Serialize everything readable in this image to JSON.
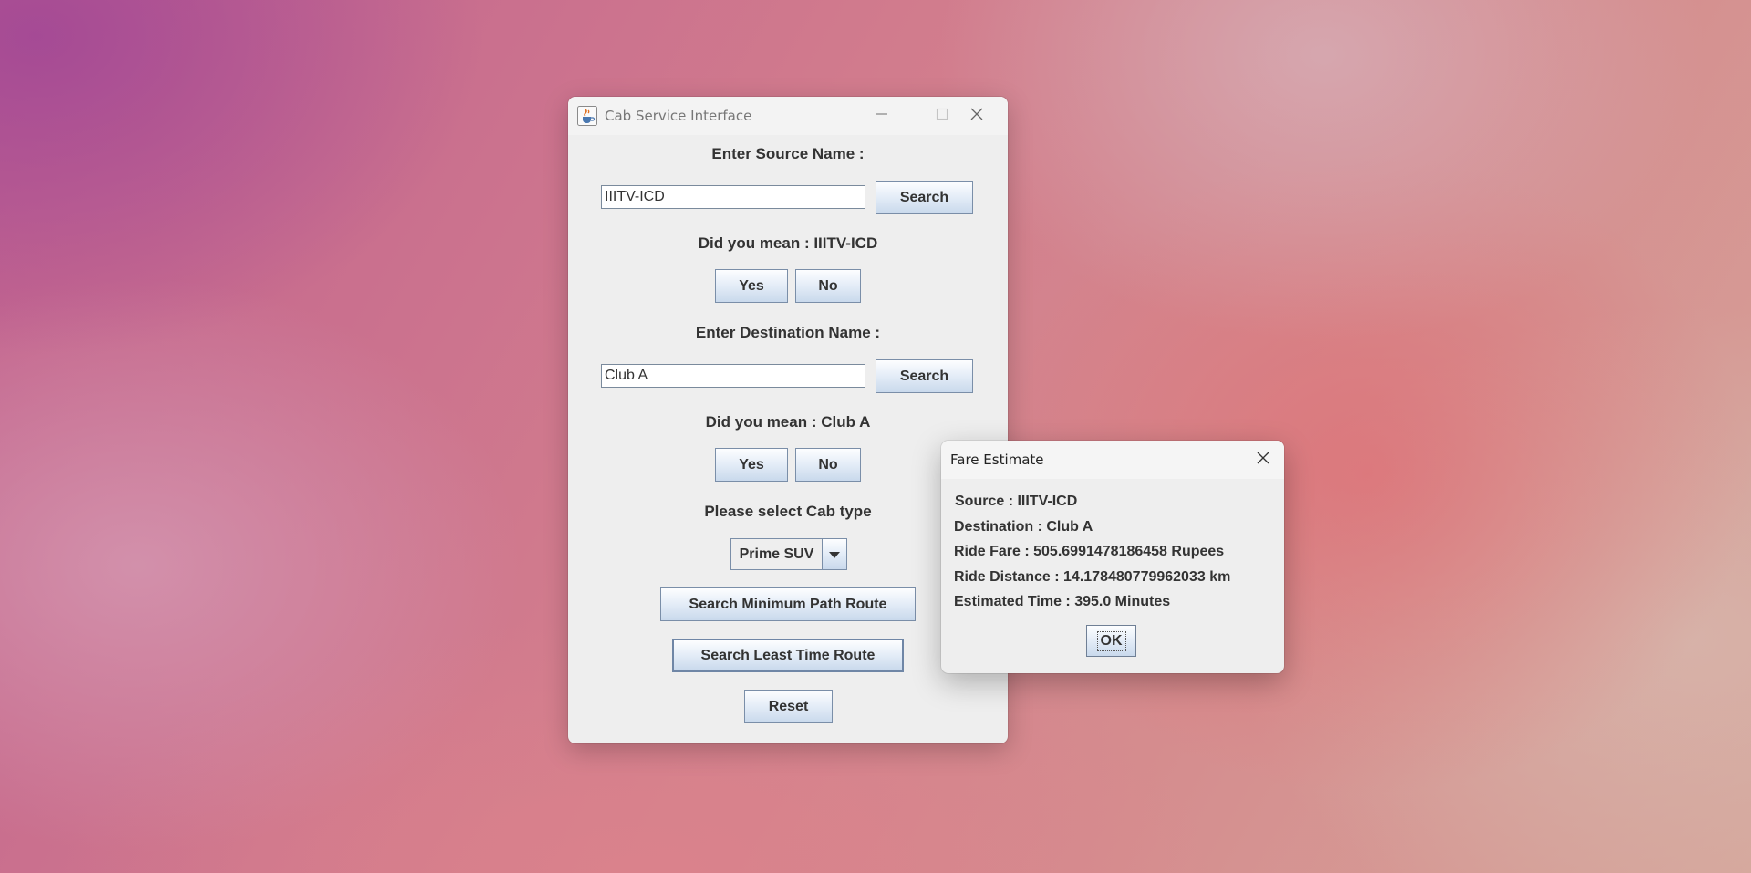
{
  "main_window": {
    "title": "Cab Service Interface",
    "source_label": "Enter Source Name :",
    "source_value": "IIITV-ICD",
    "source_search_label": "Search",
    "source_suggestion": "Did you mean : IIITV-ICD",
    "source_yes_label": "Yes",
    "source_no_label": "No",
    "destination_label": "Enter Destination Name :",
    "destination_value": "Club A",
    "destination_search_label": "Search",
    "destination_suggestion": "Did you mean : Club A",
    "destination_yes_label": "Yes",
    "destination_no_label": "No",
    "cab_type_label": "Please select Cab type",
    "cab_type_selected": "Prime SUV",
    "min_path_label": "Search Minimum Path Route",
    "least_time_label": "Search Least Time Route",
    "reset_label": "Reset"
  },
  "fare_dialog": {
    "title": "Fare Estimate",
    "source_line": "Source : IIITV-ICD",
    "destination_line": "Destination : Club A",
    "fare_line": "Ride Fare : 505.6991478186458 Rupees",
    "distance_line": "Ride Distance : 14.178480779962033 km",
    "time_line": "Estimated Time : 395.0 Minutes",
    "ok_label": "OK"
  },
  "icons": {
    "app": "java-coffee-icon",
    "minimize": "minimize-icon",
    "maximize": "maximize-icon",
    "close": "close-icon",
    "dropdown": "chevron-down-icon"
  },
  "colors": {
    "window_bg": "#eeeeee",
    "button_border": "#7a8ea8",
    "text": "#333333"
  }
}
